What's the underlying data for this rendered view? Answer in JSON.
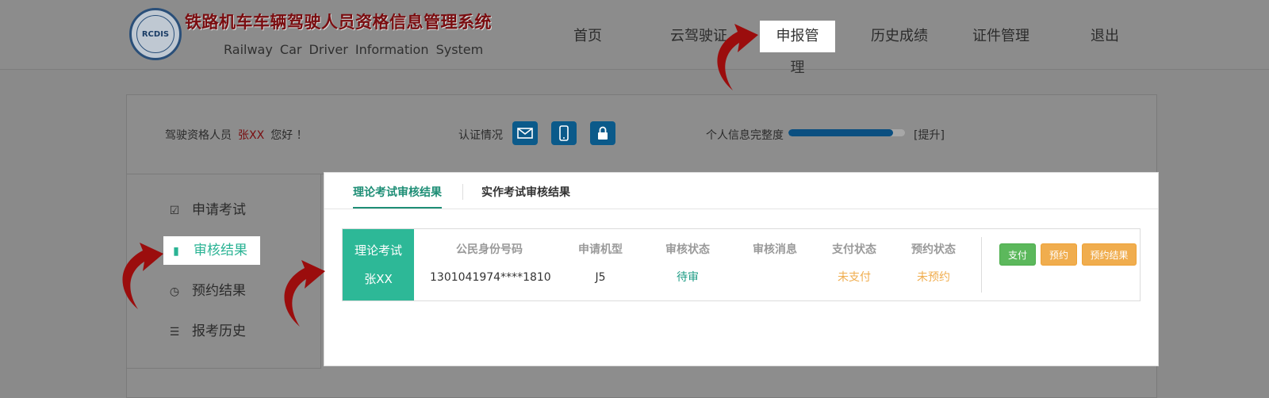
{
  "header": {
    "logo_text": "RCDIS",
    "title": "铁路机车车辆驾驶人员资格信息管理系统",
    "subtitle": "Railway  Car  Driver  Information  System",
    "nav": [
      {
        "label": "首页"
      },
      {
        "label": "云驾驶证"
      },
      {
        "label": "申报管理",
        "active": true
      },
      {
        "label": "历史成绩"
      },
      {
        "label": "证件管理"
      },
      {
        "label": "退出"
      }
    ]
  },
  "info_bar": {
    "greeting_prefix": "驾驶资格人员",
    "user_name": "张XX",
    "greeting_suffix": "您好 ！",
    "auth_label": "认证情况",
    "auth_icons": [
      "mail-icon",
      "phone-icon",
      "lock-icon"
    ],
    "completeness_label": "个人信息完整度",
    "completeness_percent": 90,
    "upgrade_link": "[提升]"
  },
  "sidebar": {
    "items": [
      {
        "label": "申请考试",
        "icon": "edit-icon"
      },
      {
        "label": "审核结果",
        "icon": "file-icon",
        "active": true
      },
      {
        "label": "预约结果",
        "icon": "clock-icon"
      },
      {
        "label": "报考历史",
        "icon": "list-icon"
      }
    ]
  },
  "card": {
    "tabs": [
      {
        "label": "理论考试审核结果",
        "active": true
      },
      {
        "label": "实作考试审核结果"
      }
    ],
    "row": {
      "exam_type": "理论考试",
      "name": "张XX",
      "columns": [
        {
          "header": "公民身份号码",
          "value": "1301041974****1810"
        },
        {
          "header": "申请机型",
          "value": "J5"
        },
        {
          "header": "审核状态",
          "value": "待审"
        },
        {
          "header": "审核消息",
          "value": ""
        },
        {
          "header": "支付状态",
          "value": "未支付"
        },
        {
          "header": "预约状态",
          "value": "未预约"
        }
      ],
      "buttons": [
        {
          "label": "支付"
        },
        {
          "label": "预约"
        },
        {
          "label": "预约结果"
        }
      ]
    }
  },
  "colors": {
    "accent_teal": "#2db897",
    "success_green": "#5cb85c",
    "warning_orange": "#f0ad4e",
    "annotation_red": "#9b0d0d",
    "header_title": "#7a0d10"
  }
}
